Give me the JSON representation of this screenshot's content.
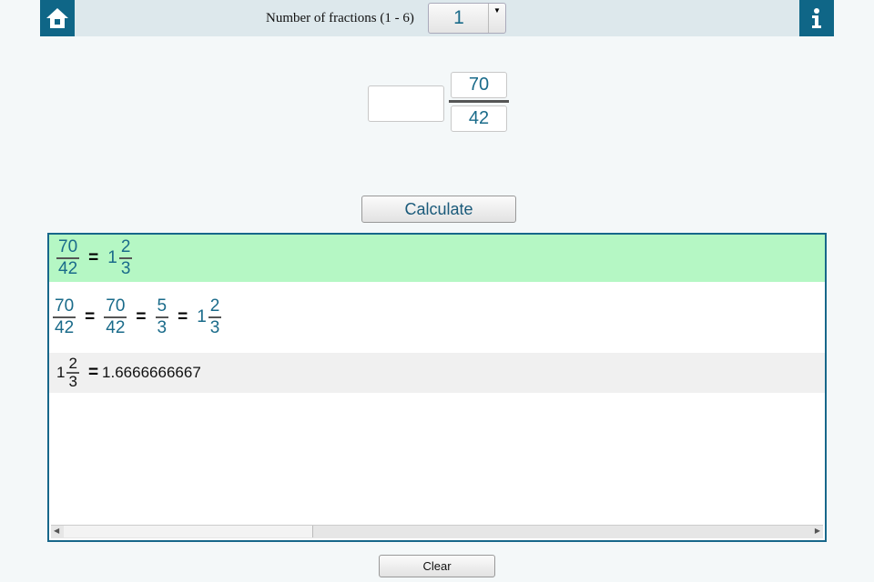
{
  "header": {
    "label": "Number of fractions (1 - 6)",
    "count_value": "1",
    "home_icon": "home-icon",
    "info_icon": "info-icon"
  },
  "input": {
    "whole": "",
    "numerator": "70",
    "denominator": "42"
  },
  "calculate_label": "Calculate",
  "results": {
    "row1": {
      "num": "70",
      "den": "42",
      "eq": "=",
      "whole": "1",
      "rnum": "2",
      "rden": "3"
    },
    "row2": {
      "n1": "70",
      "d1": "42",
      "eq": "=",
      "n2": "70",
      "d2": "42",
      "n3": "5",
      "d3": "3",
      "whole": "1",
      "rnum": "2",
      "rden": "3"
    },
    "row3": {
      "whole": "1",
      "num": "2",
      "den": "3",
      "eq": "=",
      "decimal": "1.6666666667"
    }
  },
  "clear_label": "Clear",
  "colors": {
    "accent": "#0f6687",
    "highlight": "#b5f7c4"
  }
}
